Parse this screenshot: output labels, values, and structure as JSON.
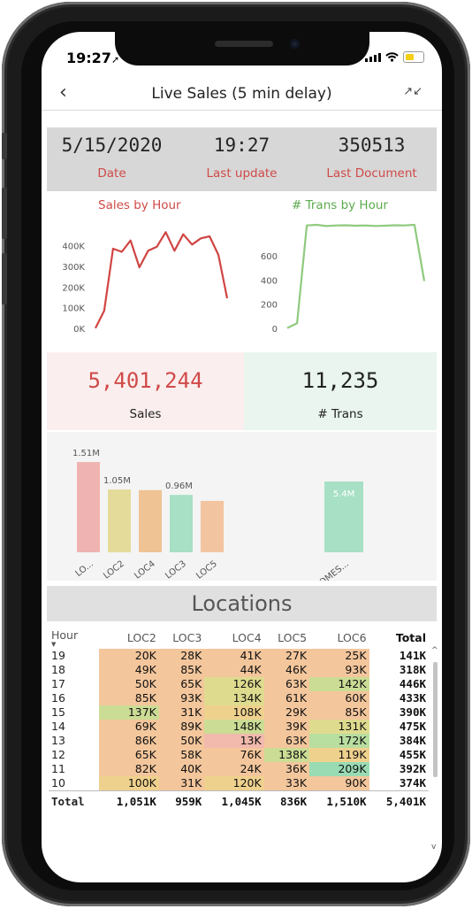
{
  "status_bar": {
    "time": "19:27",
    "location_glyph": "➚"
  },
  "nav": {
    "back_glyph": "‹",
    "title": "Live Sales (5 min delay)",
    "collapse_glyph": "↗↙"
  },
  "kpis": [
    {
      "value": "5/15/2020",
      "label": "Date"
    },
    {
      "value": "19:27",
      "label": "Last update"
    },
    {
      "value": "350513",
      "label": "Last Document"
    }
  ],
  "colors": {
    "sales_line": "#d04543",
    "trans_line": "#8fca7e",
    "kpi_label": "#cf4a48",
    "sales_card_bg": "#fbeeee",
    "trans_card_bg": "#e9f5ee"
  },
  "chart_data": [
    {
      "type": "line",
      "title": "Sales by Hour",
      "color": "#d04543",
      "y_ticks": [
        "400K",
        "300K",
        "200K",
        "100K",
        "0K"
      ],
      "ylim": [
        0,
        480000
      ],
      "values": [
        5000,
        90000,
        390000,
        375000,
        430000,
        300000,
        380000,
        400000,
        470000,
        380000,
        460000,
        410000,
        440000,
        450000,
        360000,
        150000
      ]
    },
    {
      "type": "line",
      "title": "# Trans by Hour",
      "color": "#8fca7e",
      "y_ticks": [
        "600",
        "400",
        "200",
        "0"
      ],
      "ylim": [
        0,
        880
      ],
      "values": [
        10,
        50,
        860,
        865,
        855,
        860,
        862,
        858,
        860,
        856,
        858,
        862,
        860,
        865,
        400
      ]
    },
    {
      "type": "bar",
      "categories": [
        "LO...",
        "LOC2",
        "LOC4",
        "LOC3",
        "LOC5"
      ],
      "values": [
        1.51,
        1.05,
        1.04,
        0.96,
        0.86
      ],
      "data_labels": [
        "1.51M",
        "1.05M",
        "",
        "0.96M",
        ""
      ],
      "colors": [
        "#efb4b1",
        "#e4db9a",
        "#efc393",
        "#a7e0c5",
        "#f3c4a0"
      ]
    },
    {
      "type": "bar",
      "categories": [
        "DOMES..."
      ],
      "values": [
        5.4
      ],
      "data_labels": [
        "5.4M"
      ],
      "colors": [
        "#a7e0c5"
      ]
    }
  ],
  "cards": {
    "sales": {
      "value": "5,401,244",
      "label": "Sales"
    },
    "trans": {
      "value": "11,235",
      "label": "# Trans"
    }
  },
  "locations": {
    "title": "Locations",
    "columns": [
      "Hour",
      "LOC2",
      "LOC3",
      "LOC4",
      "LOC5",
      "LOC6",
      "Total"
    ],
    "rows": [
      {
        "hour": "19",
        "cells": [
          [
            "20K",
            "#f3c69c"
          ],
          [
            "28K",
            "#f3c69c"
          ],
          [
            "41K",
            "#f3c69c"
          ],
          [
            "27K",
            "#f3c69c"
          ],
          [
            "25K",
            "#f3c69c"
          ]
        ],
        "total": "141K"
      },
      {
        "hour": "18",
        "cells": [
          [
            "49K",
            "#f3c69c"
          ],
          [
            "85K",
            "#f3c69c"
          ],
          [
            "44K",
            "#f3c69c"
          ],
          [
            "46K",
            "#f3c69c"
          ],
          [
            "93K",
            "#f3c69c"
          ]
        ],
        "total": "318K"
      },
      {
        "hour": "17",
        "cells": [
          [
            "50K",
            "#f3c69c"
          ],
          [
            "65K",
            "#f3c69c"
          ],
          [
            "126K",
            "#dedb8f"
          ],
          [
            "63K",
            "#f3c69c"
          ],
          [
            "142K",
            "#cbdc95"
          ]
        ],
        "total": "446K"
      },
      {
        "hour": "16",
        "cells": [
          [
            "85K",
            "#f3c69c"
          ],
          [
            "93K",
            "#f3c69c"
          ],
          [
            "134K",
            "#dedb8f"
          ],
          [
            "61K",
            "#f3c69c"
          ],
          [
            "60K",
            "#f3c69c"
          ]
        ],
        "total": "433K"
      },
      {
        "hour": "15",
        "cells": [
          [
            "137K",
            "#cbdc95"
          ],
          [
            "31K",
            "#f3c69c"
          ],
          [
            "108K",
            "#efd18e"
          ],
          [
            "29K",
            "#f3c69c"
          ],
          [
            "85K",
            "#f3c69c"
          ]
        ],
        "total": "390K"
      },
      {
        "hour": "14",
        "cells": [
          [
            "69K",
            "#f3c69c"
          ],
          [
            "89K",
            "#f3c69c"
          ],
          [
            "148K",
            "#cbdc95"
          ],
          [
            "39K",
            "#f3c69c"
          ],
          [
            "131K",
            "#dedb8f"
          ]
        ],
        "total": "475K"
      },
      {
        "hour": "13",
        "cells": [
          [
            "86K",
            "#f3c69c"
          ],
          [
            "50K",
            "#f3c69c"
          ],
          [
            "13K",
            "#f2b9ad"
          ],
          [
            "63K",
            "#f3c69c"
          ],
          [
            "172K",
            "#b8dea0"
          ]
        ],
        "total": "384K"
      },
      {
        "hour": "12",
        "cells": [
          [
            "65K",
            "#f3c69c"
          ],
          [
            "58K",
            "#f3c69c"
          ],
          [
            "76K",
            "#f3c69c"
          ],
          [
            "138K",
            "#cbdc95"
          ],
          [
            "119K",
            "#efd18e"
          ]
        ],
        "total": "455K"
      },
      {
        "hour": "11",
        "cells": [
          [
            "82K",
            "#f3c69c"
          ],
          [
            "40K",
            "#f3c69c"
          ],
          [
            "24K",
            "#f3c69c"
          ],
          [
            "36K",
            "#f3c69c"
          ],
          [
            "209K",
            "#99dcb4"
          ]
        ],
        "total": "392K"
      },
      {
        "hour": "10",
        "cells": [
          [
            "100K",
            "#efd18e"
          ],
          [
            "31K",
            "#f3c69c"
          ],
          [
            "120K",
            "#efd18e"
          ],
          [
            "33K",
            "#f3c69c"
          ],
          [
            "90K",
            "#f3c69c"
          ]
        ],
        "total": "374K"
      }
    ],
    "total_row": {
      "label": "Total",
      "values": [
        "1,051K",
        "959K",
        "1,045K",
        "836K",
        "1,510K",
        "5,401K"
      ]
    }
  }
}
